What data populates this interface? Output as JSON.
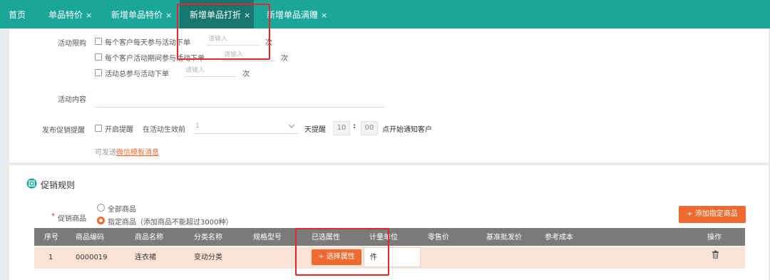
{
  "tabs": [
    {
      "label": "首页",
      "closable": false,
      "active": false
    },
    {
      "label": "单品特价",
      "closable": true,
      "active": false
    },
    {
      "label": "新增单品特价",
      "closable": true,
      "active": false
    },
    {
      "label": "新增单品打折",
      "closable": true,
      "active": true
    },
    {
      "label": "新增单品满赠",
      "closable": true,
      "active": false
    }
  ],
  "close_glyph": "×",
  "form": {
    "limit_label": "活动限购",
    "limit_options": [
      {
        "text": "每个客户每天参与活动下单",
        "placeholder": "请输入",
        "suffix": "次"
      },
      {
        "text": "每个客户活动期间参与活动下单",
        "placeholder": "请输入",
        "suffix": "次"
      },
      {
        "text": "活动总参与活动下单",
        "placeholder": "请输入",
        "suffix": "次"
      }
    ],
    "content_label": "活动内容",
    "reminder_label": "发布促销提醒",
    "reminder_checkbox": "开启提醒",
    "reminder_prefix": "在活动生效前",
    "reminder_days_value": "1",
    "reminder_days_suffix": "天提醒",
    "reminder_hour": "10",
    "reminder_colon": ":",
    "reminder_minute": "00",
    "reminder_suffix": "点开始通知客户",
    "hint_prefix": "可发送",
    "hint_link": "微信模板消息"
  },
  "rules": {
    "title": "促销规则",
    "required_mark": "*",
    "goods_label": "促销商品",
    "option_all": "全部商品",
    "option_specified": "指定商品（添加商品不能超过3000种）",
    "add_button": "+ 添加指定商品",
    "columns": [
      "序号",
      "商品编码",
      "商品名称",
      "分类名称",
      "规格型号",
      "已选属性",
      "计量单位",
      "零售价",
      "基准批发价",
      "参考成本",
      "操作"
    ],
    "rows": [
      {
        "index": "1",
        "code": "0000019",
        "name": "连衣裙",
        "category": "变动分类",
        "spec": "",
        "select_attr_button": "+ 选择属性",
        "unit": "件",
        "retail": "",
        "wholesale": "",
        "cost": ""
      }
    ]
  },
  "colors": {
    "teal": "#1aa79a",
    "teal_dark": "#17776e",
    "orange": "#f0692f",
    "highlight": "#e8262d"
  }
}
